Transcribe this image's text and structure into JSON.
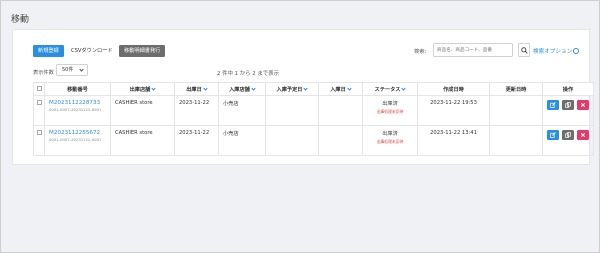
{
  "page": {
    "title": "移動"
  },
  "toolbar": {
    "new_label": "新規登録",
    "csv_label": "CSVダウンロード",
    "slip_label": "移動明細書発行"
  },
  "search": {
    "label": "検索：",
    "placeholder": "商品名、商品コード、品番",
    "options_label": "検索オプション"
  },
  "pagination": {
    "per_page_label": "表示件数",
    "per_page_value": "50件",
    "count_text": "2 件中 1 から 2 まで表示"
  },
  "table": {
    "headers": [
      "",
      "移動番号",
      "出庫店舗",
      "出庫日",
      "入庫店舗",
      "入庫予定日",
      "入庫日",
      "ステータス",
      "作成日時",
      "更新日時",
      "操作"
    ],
    "rows": [
      {
        "number": "M2023112228733",
        "sub_number": "0001-0007-20231122-0001",
        "from_store": "CASHIER store",
        "ship_date": "2023-11-22",
        "to_store": "小売店",
        "planned_date": "",
        "received_date": "",
        "status": "出庫済",
        "status_sub": "出庫処理未反映",
        "created": "2023-11-22 19:53",
        "updated": ""
      },
      {
        "number": "M2023112255672",
        "sub_number": "0001-0007-20231122-0001",
        "from_store": "CASHIER store",
        "ship_date": "2023-11-22",
        "to_store": "小売店",
        "planned_date": "",
        "received_date": "",
        "status": "出庫済",
        "status_sub": "出庫処理未反映",
        "created": "2023-11-22 13:41",
        "updated": ""
      }
    ]
  },
  "icons": {
    "edit": "edit-icon",
    "copy": "copy-icon",
    "delete": "delete-icon",
    "search": "search-icon"
  },
  "colors": {
    "primary": "#2a8fe0",
    "danger": "#e8386b",
    "neutral": "#6d6d6d",
    "alert_text": "#e0443e"
  }
}
